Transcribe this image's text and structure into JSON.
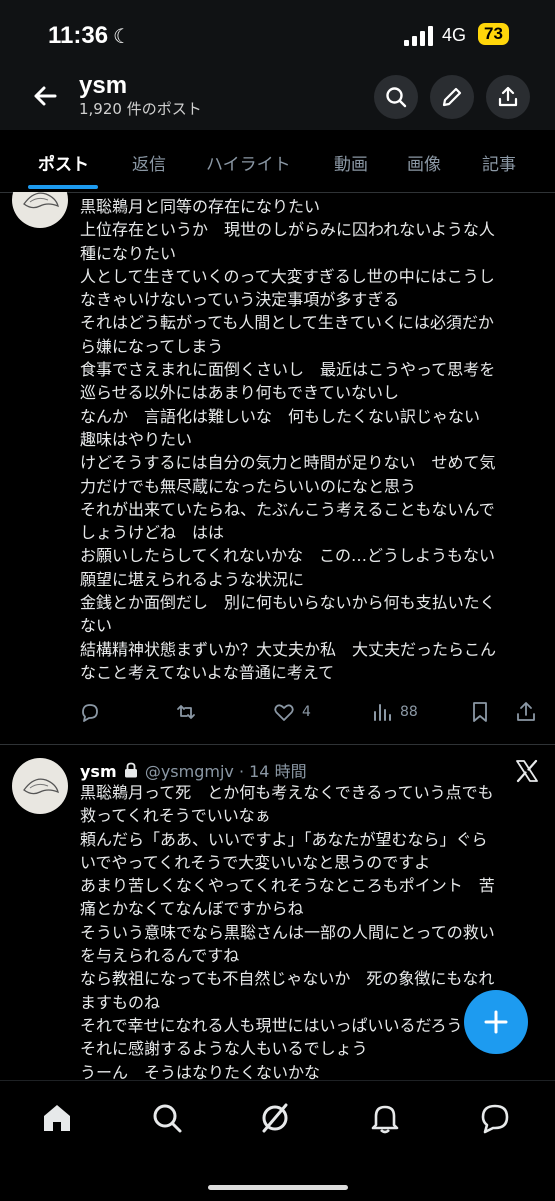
{
  "status": {
    "time": "11:36",
    "network": "4G",
    "battery": "73"
  },
  "header": {
    "name": "ysm",
    "post_count": "1,920 件のポスト"
  },
  "tabs": [
    {
      "label": "ポスト"
    },
    {
      "label": "返信"
    },
    {
      "label": "ハイライト"
    },
    {
      "label": "動画"
    },
    {
      "label": "画像"
    },
    {
      "label": "記事"
    }
  ],
  "post1": {
    "lines": [
      "黒聡鵜月と同等の存在になりたい",
      "上位存在というか　現世のしがらみに囚われないような人",
      "種になりたい",
      "人として生きていくのって大変すぎるし世の中にはこうし",
      "なきゃいけないっていう決定事項が多すぎる",
      "それはどう転がっても人間として生きていくには必須だか",
      "ら嫌になってしまう",
      "食事でさえまれに面倒くさいし　最近はこうやって思考を",
      "巡らせる以外にはあまり何もできていないし",
      "なんか　言語化は難しいな　何もしたくない訳じゃない",
      "趣味はやりたい",
      "けどそうするには自分の気力と時間が足りない　せめて気",
      "力だけでも無尽蔵になったらいいのになと思う",
      "それが出来ていたらね、たぶんこう考えることもないんで",
      "しょうけどね　はは",
      "お願いしたらしてくれないかな　この…どうしようもない",
      "願望に堪えられるような状況に",
      "金銭とか面倒だし　別に何もいらないから何も支払いたく",
      "ない",
      "結構精神状態まずいか？大丈夫か私　大丈夫だったらこん",
      "なこと考えてないよな普通に考えて"
    ],
    "likes": "4",
    "views": "88"
  },
  "post2": {
    "name": "ysm",
    "handle": "@ysmgmjv",
    "time": "· 14 時間",
    "lines": [
      "黒聡鵜月って死　とか何も考えなくできるっていう点でも",
      "救ってくれそうでいいなぁ",
      "頼んだら「ああ、いいですよ」「あなたが望むなら」ぐら",
      "いでやってくれそうで大変いいなと思うのですよ",
      "あまり苦しくなくやってくれそうなところもポイント　苦",
      "痛とかなくてなんぼですからね",
      "そういう意味でなら黒聡さんは一部の人間にとっての救い",
      "を与えられるんですね",
      "なら教祖になっても不自然じゃないか　死の象徴にもなれ",
      "ますものね",
      "それで幸せになれる人も現世にはいっぱいいるだろうし",
      "それに感謝するような人もいるでしょう",
      "うーん　そうはなりたくないかな"
    ]
  },
  "colors": {
    "accent": "#1d9bf0",
    "battery": "#ffd60a",
    "muted": "#8b98a5"
  }
}
